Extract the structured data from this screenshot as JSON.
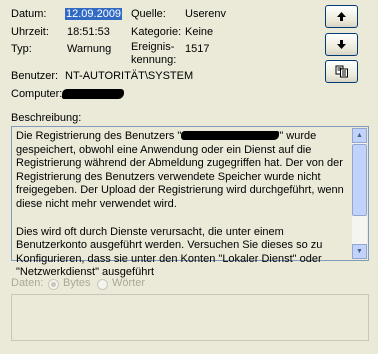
{
  "header": {
    "datum_label": "Datum:",
    "datum_value": "12.09.2009",
    "uhrzeit_label": "Uhrzeit:",
    "uhrzeit_value": "18:51:53",
    "typ_label": "Typ:",
    "typ_value": "Warnung",
    "quelle_label": "Quelle:",
    "quelle_value": "Userenv",
    "kategorie_label": "Kategorie:",
    "kategorie_value": "Keine",
    "ereignis_label_1": "Ereignis-",
    "ereignis_label_2": "kennung:",
    "ereignis_value": "1517",
    "benutzer_label": "Benutzer:",
    "benutzer_value": "NT-AUTORITÄT\\SYSTEM",
    "computer_label": "Computer:"
  },
  "nav": {
    "up_icon": "arrow-up-icon",
    "down_icon": "arrow-down-icon",
    "copy_icon": "copy-icon"
  },
  "description": {
    "label": "Beschreibung:",
    "text_1a": "Die Registrierung des Benutzers \"",
    "text_1b": "\" wurde gespeichert, obwohl  eine Anwendung oder ein Dienst auf die Registrierung während der Abmeldung zugegriffen hat. Der von der Registrierung des Benutzers verwendete Speicher wurde nicht freigegeben. Der Upload der Registrierung wird durchgeführt, wenn diese nicht mehr verwendet wird.",
    "text_2": " Dies wird oft durch Dienste verursacht, die unter einem Benutzerkonto ausgeführt werden. Versuchen Sie dieses so zu Konfigurieren, dass sie unter den Konten \"Lokaler Dienst\" oder \"Netzwerkdienst\" ausgeführt"
  },
  "data_section": {
    "label": "Daten:",
    "option_bytes": "Bytes",
    "option_woerter": "Wörter",
    "selected": "Bytes"
  }
}
